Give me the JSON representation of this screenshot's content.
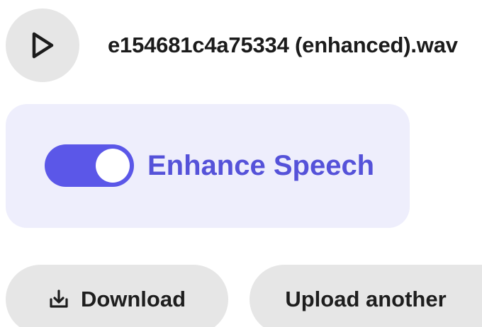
{
  "file": {
    "name": "e154681c4a75334 (enhanced).wav",
    "play_icon": "play-icon"
  },
  "enhance": {
    "label": "Enhance Speech",
    "enabled": true,
    "accent_color": "#5b57e8"
  },
  "actions": {
    "download_label": "Download",
    "download_icon": "download-icon",
    "upload_label": "Upload another"
  }
}
